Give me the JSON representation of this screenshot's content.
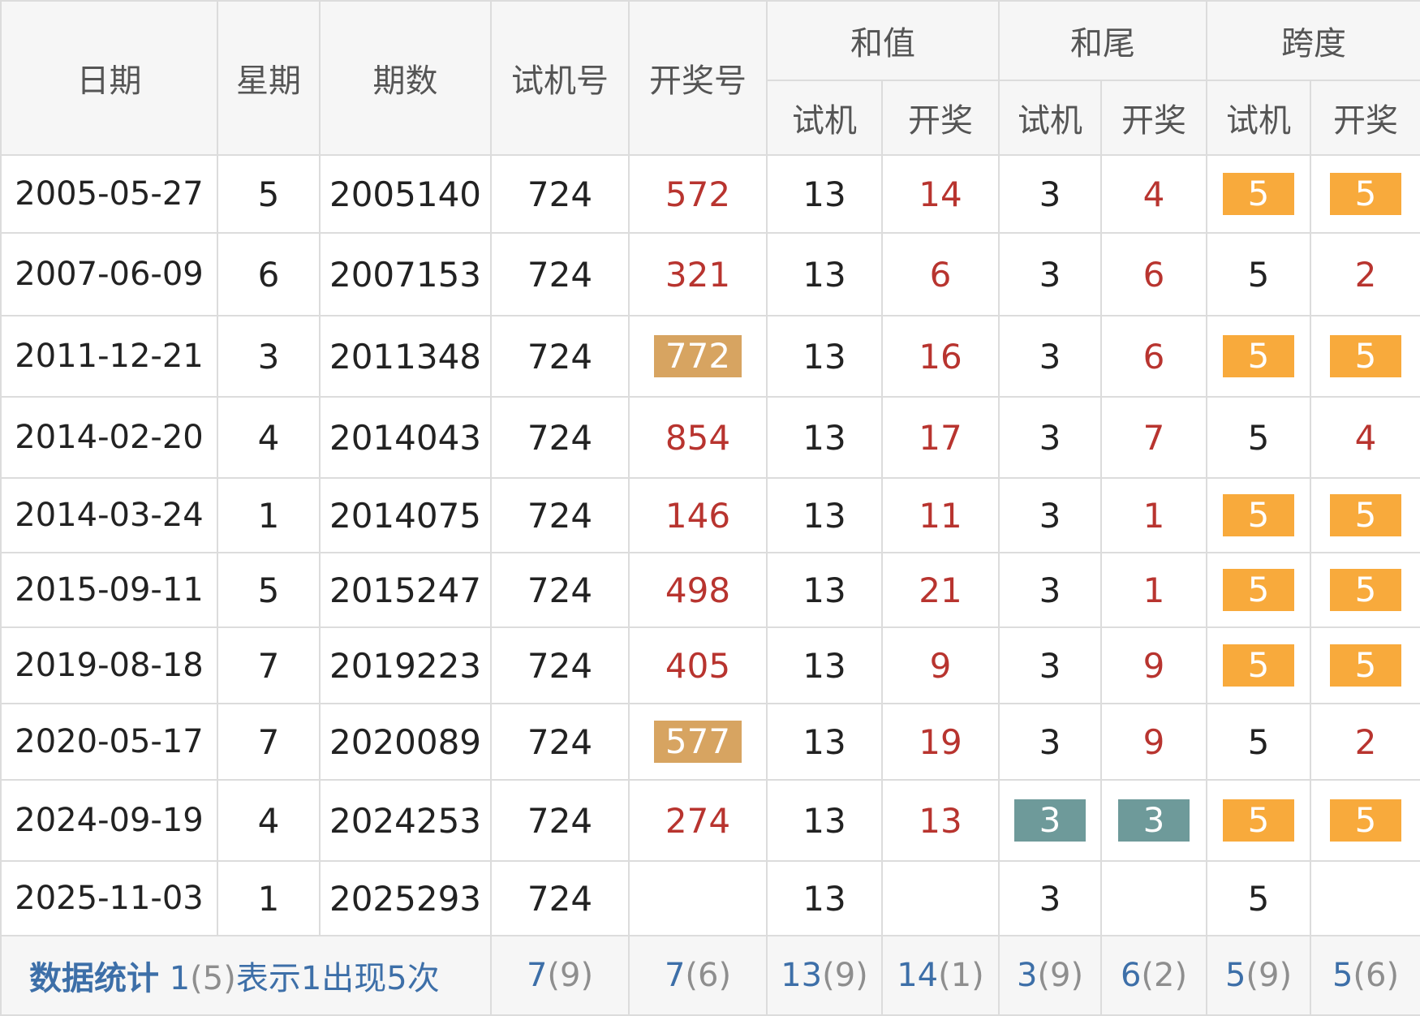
{
  "header": {
    "date": "日期",
    "weekday": "星期",
    "issue": "期数",
    "trial_no": "试机号",
    "draw_no": "开奖号",
    "sum_group": "和值",
    "tail_group": "和尾",
    "span_group": "跨度",
    "sub_trial": "试机",
    "sub_draw": "开奖"
  },
  "rows": [
    {
      "date": "2005-05-27",
      "weekday": "5",
      "issue": "2005140",
      "trial": "724",
      "draw": "572",
      "sum_trial": "13",
      "sum_draw": "14",
      "tail_trial": "3",
      "tail_draw": "4",
      "span_trial": "5",
      "span_draw": "5"
    },
    {
      "date": "2007-06-09",
      "weekday": "6",
      "issue": "2007153",
      "trial": "724",
      "draw": "321",
      "sum_trial": "13",
      "sum_draw": "6",
      "tail_trial": "3",
      "tail_draw": "6",
      "span_trial": "5",
      "span_draw": "2"
    },
    {
      "date": "2011-12-21",
      "weekday": "3",
      "issue": "2011348",
      "trial": "724",
      "draw": "772",
      "sum_trial": "13",
      "sum_draw": "16",
      "tail_trial": "3",
      "tail_draw": "6",
      "span_trial": "5",
      "span_draw": "5"
    },
    {
      "date": "2014-02-20",
      "weekday": "4",
      "issue": "2014043",
      "trial": "724",
      "draw": "854",
      "sum_trial": "13",
      "sum_draw": "17",
      "tail_trial": "3",
      "tail_draw": "7",
      "span_trial": "5",
      "span_draw": "4"
    },
    {
      "date": "2014-03-24",
      "weekday": "1",
      "issue": "2014075",
      "trial": "724",
      "draw": "146",
      "sum_trial": "13",
      "sum_draw": "11",
      "tail_trial": "3",
      "tail_draw": "1",
      "span_trial": "5",
      "span_draw": "5"
    },
    {
      "date": "2015-09-11",
      "weekday": "5",
      "issue": "2015247",
      "trial": "724",
      "draw": "498",
      "sum_trial": "13",
      "sum_draw": "21",
      "tail_trial": "3",
      "tail_draw": "1",
      "span_trial": "5",
      "span_draw": "5"
    },
    {
      "date": "2019-08-18",
      "weekday": "7",
      "issue": "2019223",
      "trial": "724",
      "draw": "405",
      "sum_trial": "13",
      "sum_draw": "9",
      "tail_trial": "3",
      "tail_draw": "9",
      "span_trial": "5",
      "span_draw": "5"
    },
    {
      "date": "2020-05-17",
      "weekday": "7",
      "issue": "2020089",
      "trial": "724",
      "draw": "577",
      "sum_trial": "13",
      "sum_draw": "19",
      "tail_trial": "3",
      "tail_draw": "9",
      "span_trial": "5",
      "span_draw": "2"
    },
    {
      "date": "2024-09-19",
      "weekday": "4",
      "issue": "2024253",
      "trial": "724",
      "draw": "274",
      "sum_trial": "13",
      "sum_draw": "13",
      "tail_trial": "3",
      "tail_draw": "3",
      "span_trial": "5",
      "span_draw": "5"
    },
    {
      "date": "2025-11-03",
      "weekday": "1",
      "issue": "2025293",
      "trial": "724",
      "draw": "",
      "sum_trial": "13",
      "sum_draw": "",
      "tail_trial": "3",
      "tail_draw": "",
      "span_trial": "5",
      "span_draw": ""
    }
  ],
  "footer": {
    "label": "数据统计",
    "legend": {
      "pre": "1",
      "paren": "(5)",
      "text": "表示1出现5次"
    },
    "trial": {
      "num": "7",
      "paren": "(9)"
    },
    "draw": {
      "num": "7",
      "paren": "(6)"
    },
    "sum_trial": {
      "num": "13",
      "paren": "(9)"
    },
    "sum_draw": {
      "num": "14",
      "paren": "(1)"
    },
    "tail_trial": {
      "num": "3",
      "paren": "(9)"
    },
    "tail_draw": {
      "num": "6",
      "paren": "(2)"
    },
    "span_trial": {
      "num": "5",
      "paren": "(9)"
    },
    "span_draw": {
      "num": "5",
      "paren": "(6)"
    }
  },
  "colors": {
    "draw_text": "#b8342f",
    "tan_highlight": "#d7a461",
    "orange_highlight": "#f8aa3c",
    "teal_highlight": "#6e9a9a",
    "footer_link": "#3d6fa8",
    "header_bg": "#f6f6f6",
    "border": "#dcdcdc"
  }
}
